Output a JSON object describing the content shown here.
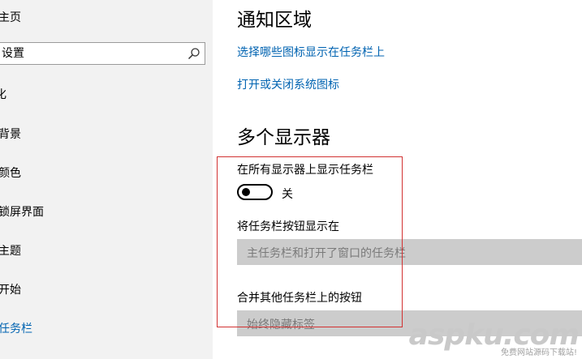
{
  "sidebar": {
    "home_label": "主页",
    "search_placeholder": "设置",
    "items": [
      {
        "label": "化"
      },
      {
        "label": "背景"
      },
      {
        "label": "颜色"
      },
      {
        "label": "锁屏界面"
      },
      {
        "label": "主题"
      },
      {
        "label": "开始"
      },
      {
        "label": "任务栏",
        "active": true
      }
    ]
  },
  "main": {
    "notification_area": {
      "title": "通知区域",
      "link_select_icons": "选择哪些图标显示在任务栏上",
      "link_system_icons": "打开或关闭系统图标"
    },
    "multiple_displays": {
      "title": "多个显示器",
      "show_taskbar_label": "在所有显示器上显示任务栏",
      "toggle_state": "关",
      "show_buttons_label": "将任务栏按钮显示在",
      "show_buttons_value": "主任务栏和打开了窗口的任务栏",
      "combine_label": "合并其他任务栏上的按钮",
      "combine_value": "始终隐藏标签"
    }
  },
  "colors": {
    "accent": "#0063b1",
    "highlight_border": "#d23232"
  },
  "watermark": {
    "text": "aspku.com",
    "subtext": "免费网站源码下载站!"
  }
}
